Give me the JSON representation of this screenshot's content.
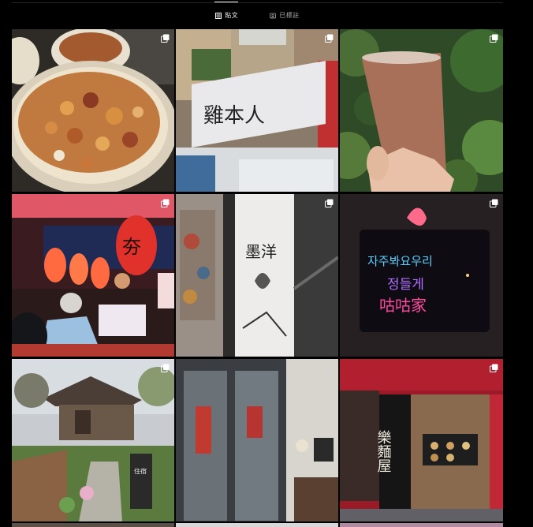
{
  "tabs": [
    {
      "label": "貼文",
      "icon": "grid-icon",
      "active": true
    },
    {
      "label": "已標註",
      "icon": "tagged-icon",
      "active": false
    }
  ],
  "posts": [
    {
      "name": "braised-pork-rice",
      "multi": true,
      "sign_text": ""
    },
    {
      "name": "storefront-sign",
      "multi": true,
      "sign_text": "雞本人"
    },
    {
      "name": "iced-tea-cup",
      "multi": true,
      "sign_text": ""
    },
    {
      "name": "night-market-stall",
      "multi": true,
      "sign_text": "夯"
    },
    {
      "name": "mural-wall",
      "multi": true,
      "sign_text": "墨洋"
    },
    {
      "name": "neon-sign",
      "multi": true,
      "sign_text": "자주봐요우리 정들게 咕咕家"
    },
    {
      "name": "japanese-house",
      "multi": true,
      "sign_text": "住宿"
    },
    {
      "name": "cafe-entrance",
      "multi": false,
      "sign_text": ""
    },
    {
      "name": "ramen-shop-front",
      "multi": true,
      "sign_text": "樂麵屋"
    }
  ],
  "colors": {
    "background": "#000000",
    "text_active": "#f5f5f5",
    "text_inactive": "#a8a8a8"
  }
}
